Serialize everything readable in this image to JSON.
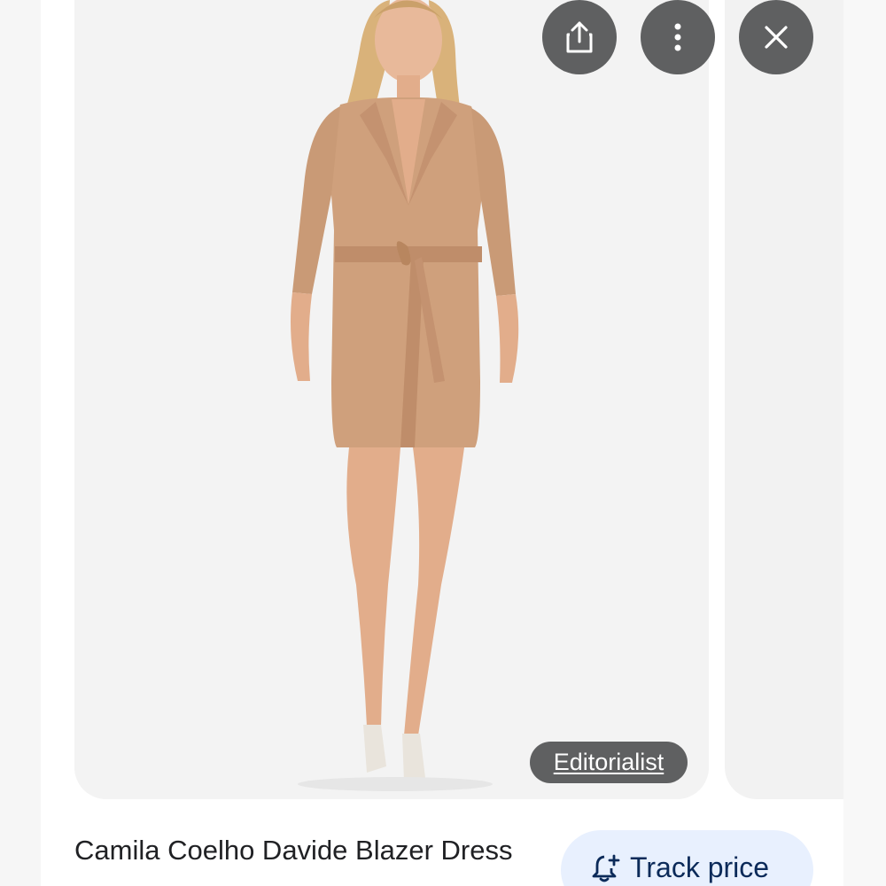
{
  "product": {
    "title": "Camila Coelho Davide Blazer Dress",
    "image_description_icon": "blazer-dress-photo"
  },
  "source": {
    "label": "Editorialist"
  },
  "actions": {
    "share_icon": "share-icon",
    "more_icon": "more-vertical-icon",
    "close_icon": "close-icon",
    "track_label": "Track price",
    "track_icon": "bell-plus-icon"
  },
  "colors": {
    "fab_bg": "#5f6061",
    "track_bg": "#e8f0fe",
    "track_text": "#0b2a59",
    "dress": "#cfa07c"
  }
}
